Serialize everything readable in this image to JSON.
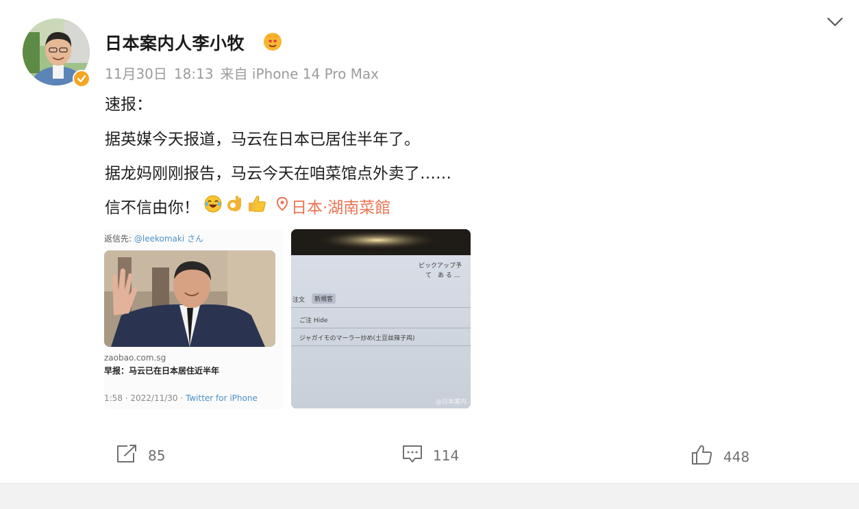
{
  "post": {
    "author": "日本案内人李小牧",
    "date": "11月30日",
    "time": "18:13",
    "source": "来自 iPhone 14 Pro Max",
    "lines": [
      "速报：",
      "据英媒今天报道，马云在日本已居住半年了。",
      "据龙妈刚刚报告，马云今天在咱菜馆点外卖了……",
      "信不信由你！"
    ],
    "emojis": [
      "laugh-cry-emoji",
      "ok-hand-emoji",
      "thumbs-up-emoji"
    ],
    "location": "日本·湖南菜館"
  },
  "images": {
    "tweet": {
      "header_prefix": "返信先: ",
      "header_handle": "@leekomaki さん",
      "domain": "zaobao.com.sg",
      "headline": "早报：马云已在日本居住近半年",
      "footer_time": "1:58 · 2022/11/30 · ",
      "footer_source": "Twitter for iPhone"
    },
    "tablet": {
      "pickup": "ピックアップ予",
      "pickup2": "て　あ る …",
      "tab1": "注文",
      "tab2": "新規客",
      "order_label": "ご注 Hide",
      "order_item": "ジャガイモのマーラー炒め(土豆丝辣子鸡)",
      "watermark": "@日本案内"
    }
  },
  "actions": {
    "repost_count": "85",
    "comment_count": "114",
    "like_count": "448"
  },
  "colors": {
    "link_orange": "#eb7350",
    "verified": "#f5a623",
    "meta_gray": "#9b9b9b"
  }
}
